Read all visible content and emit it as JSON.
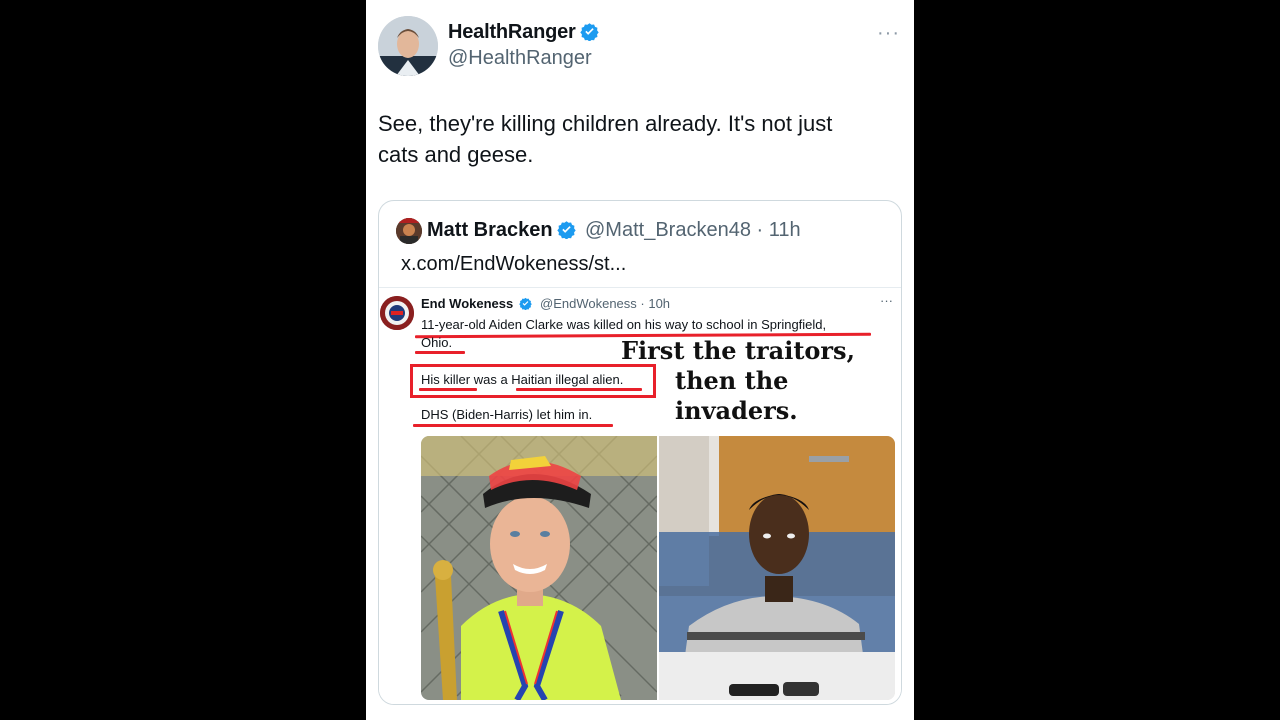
{
  "tweet": {
    "author": {
      "name": "HealthRanger",
      "handle": "@HealthRanger",
      "verified": true,
      "avatar_icon": "profile-photo"
    },
    "more_icon": "ellipsis-icon",
    "text": "See, they're killing children already. It's not just cats and geese.",
    "colors": {
      "verified": "#1d9bf0",
      "text": "#0f1419",
      "secondary": "#536471"
    }
  },
  "quote": {
    "author": {
      "name": "Matt Bracken",
      "handle_time": "@Matt_Bracken48 · 11h",
      "verified": true
    },
    "link": "x.com/EndWokeness/st...",
    "embedded": {
      "author": {
        "name": "End Wokeness",
        "handle_time": "@EndWokeness · 10h",
        "verified": true
      },
      "more": "···",
      "lines": [
        "11-year-old Aiden Clarke was killed on his way to school in Springfield,",
        "Ohio.",
        "His killer was a Haitian illegal alien.",
        "DHS (Biden-Harris) let him in."
      ],
      "overlay_lines": [
        "First the traitors,",
        "then the",
        "invaders."
      ],
      "highlight_color": "#e8202a",
      "photos": [
        "boy-with-medal-and-trophy",
        "man-in-striped-jail-uniform"
      ]
    }
  }
}
